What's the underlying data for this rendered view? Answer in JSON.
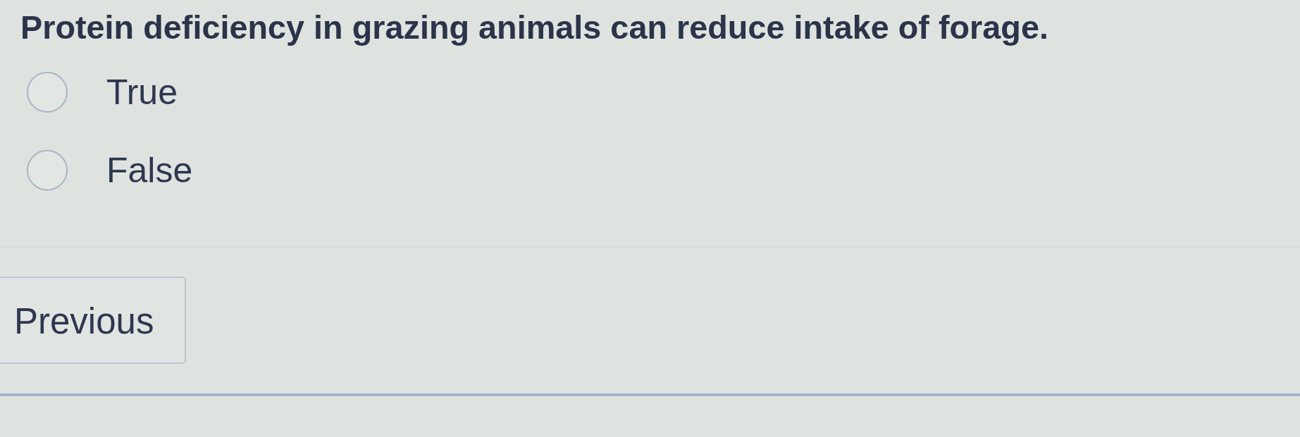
{
  "question": {
    "text": "Protein deficiency in grazing animals can reduce intake of forage."
  },
  "options": [
    {
      "label": "True",
      "selected": false
    },
    {
      "label": "False",
      "selected": false
    }
  ],
  "navigation": {
    "previous_button": "Previous"
  }
}
